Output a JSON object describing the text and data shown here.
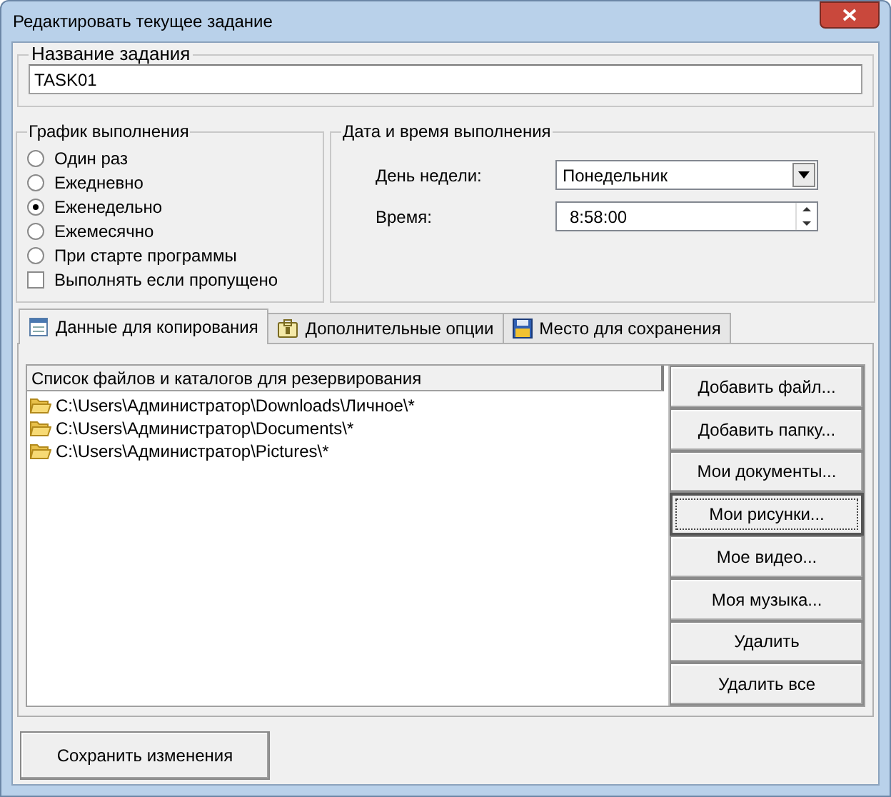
{
  "window": {
    "title": "Редактировать текущее задание"
  },
  "task_name": {
    "legend": "Название задания",
    "value": "TASK01"
  },
  "schedule": {
    "legend": "График выполнения",
    "options": [
      {
        "label": "Один раз",
        "selected": false
      },
      {
        "label": "Ежедневно",
        "selected": false
      },
      {
        "label": "Еженедельно",
        "selected": true
      },
      {
        "label": "Ежемесячно",
        "selected": false
      },
      {
        "label": "При старте программы",
        "selected": false
      }
    ],
    "run_if_missed": {
      "label": "Выполнять если пропущено",
      "checked": false
    }
  },
  "datetime": {
    "legend": "Дата и время выполнения",
    "day_label": "День недели:",
    "day_value": "Понедельник",
    "time_label": "Время:",
    "time_value": "8:58:00"
  },
  "tabs": [
    {
      "label": "Данные для копирования",
      "kind": "list",
      "selected": true
    },
    {
      "label": "Дополнительные опции",
      "kind": "options",
      "selected": false
    },
    {
      "label": "Место для сохранения",
      "kind": "disk",
      "selected": false
    }
  ],
  "file_list": {
    "header": "Список файлов и каталогов для резервирования",
    "items": [
      "C:\\Users\\Администратор\\Downloads\\Личное\\*",
      "C:\\Users\\Администратор\\Documents\\*",
      "C:\\Users\\Администратор\\Pictures\\*"
    ]
  },
  "side_buttons": [
    {
      "label": "Добавить файл...",
      "focused": false
    },
    {
      "label": "Добавить папку...",
      "focused": false
    },
    {
      "label": "Мои документы...",
      "focused": false
    },
    {
      "label": "Мои рисунки...",
      "focused": true
    },
    {
      "label": "Мое видео...",
      "focused": false
    },
    {
      "label": "Моя музыка...",
      "focused": false
    },
    {
      "label": "Удалить",
      "focused": false
    },
    {
      "label": "Удалить все",
      "focused": false
    }
  ],
  "save_button": "Сохранить изменения"
}
